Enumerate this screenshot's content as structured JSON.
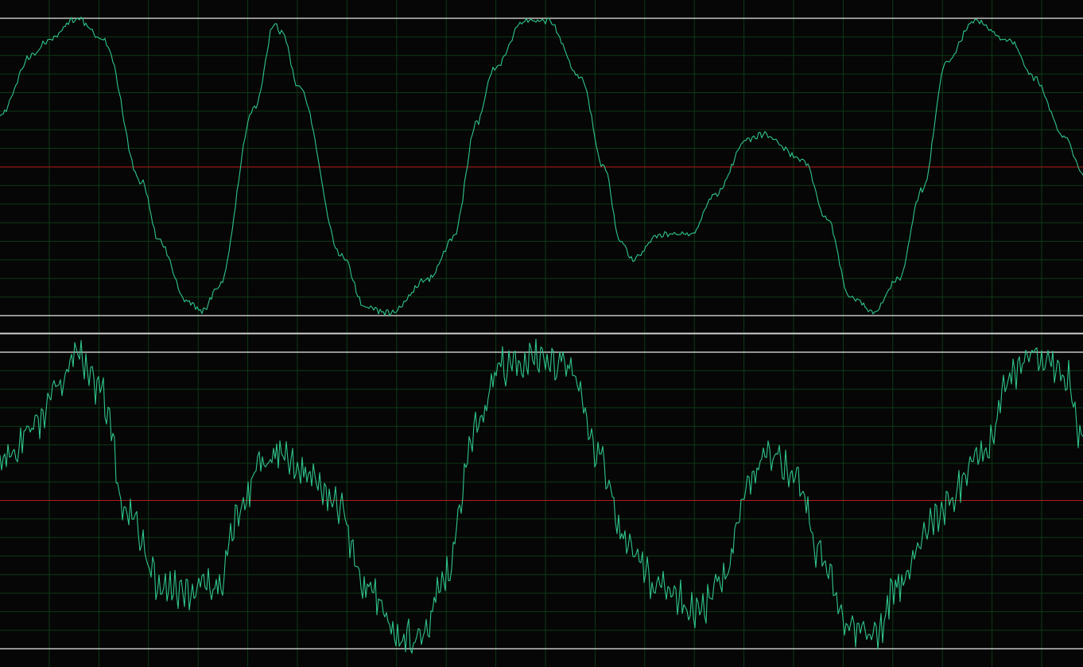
{
  "colors": {
    "background": "#060606",
    "grid": "#0e3a17",
    "waveform": "#2fc58a",
    "clip_line": "#e9e9e9",
    "zero_line": "#b81a1a",
    "divider": "#cfcfcf"
  },
  "waveform_view": {
    "grid_visible": true,
    "channels": [
      {
        "name": "",
        "clip_level_top": 1,
        "clip_level_bottom": -1,
        "zero_line": 0,
        "noise_amplitude": 0.015,
        "envelope": [
          [
            0,
            -0.35
          ],
          [
            40,
            -0.75
          ],
          [
            60,
            -0.85
          ],
          [
            97,
            -1.0
          ],
          [
            130,
            -0.85
          ],
          [
            178,
            0.1
          ],
          [
            200,
            0.5
          ],
          [
            235,
            0.9
          ],
          [
            255,
            0.97
          ],
          [
            275,
            0.8
          ],
          [
            320,
            -0.4
          ],
          [
            345,
            -0.95
          ],
          [
            355,
            -0.9
          ],
          [
            375,
            -0.55
          ],
          [
            430,
            0.6
          ],
          [
            460,
            0.95
          ],
          [
            490,
            0.98
          ],
          [
            540,
            0.75
          ],
          [
            570,
            0.48
          ],
          [
            600,
            -0.3
          ],
          [
            620,
            -0.65
          ],
          [
            660,
            -0.98
          ],
          [
            690,
            -0.98
          ],
          [
            730,
            -0.6
          ],
          [
            760,
            0.0
          ],
          [
            780,
            0.5
          ],
          [
            795,
            0.62
          ],
          [
            830,
            0.45
          ],
          [
            870,
            0.45
          ],
          [
            900,
            0.18
          ],
          [
            940,
            -0.18
          ],
          [
            960,
            -0.22
          ],
          [
            1010,
            -0.05
          ],
          [
            1040,
            0.35
          ],
          [
            1070,
            0.88
          ],
          [
            1100,
            0.97
          ],
          [
            1130,
            0.75
          ],
          [
            1160,
            0.15
          ],
          [
            1190,
            -0.7
          ],
          [
            1225,
            -0.98
          ],
          [
            1270,
            -0.85
          ],
          [
            1300,
            -0.6
          ],
          [
            1340,
            -0.2
          ],
          [
            1362,
            0.05
          ]
        ]
      },
      {
        "name": "",
        "clip_level_top": 1,
        "clip_level_bottom": -1,
        "zero_line": 0,
        "noise_amplitude": 0.09,
        "envelope": [
          [
            0,
            -0.28
          ],
          [
            45,
            -0.5
          ],
          [
            70,
            -0.75
          ],
          [
            97,
            -0.98
          ],
          [
            125,
            -0.75
          ],
          [
            160,
            0.05
          ],
          [
            200,
            0.55
          ],
          [
            240,
            0.62
          ],
          [
            275,
            0.55
          ],
          [
            300,
            0.1
          ],
          [
            330,
            -0.25
          ],
          [
            350,
            -0.32
          ],
          [
            380,
            -0.2
          ],
          [
            420,
            0.0
          ],
          [
            460,
            0.6
          ],
          [
            500,
            0.9
          ],
          [
            530,
            0.95
          ],
          [
            560,
            0.5
          ],
          [
            600,
            -0.5
          ],
          [
            630,
            -0.9
          ],
          [
            680,
            -0.97
          ],
          [
            720,
            -0.9
          ],
          [
            750,
            -0.3
          ],
          [
            790,
            0.3
          ],
          [
            830,
            0.6
          ],
          [
            880,
            0.75
          ],
          [
            910,
            0.5
          ],
          [
            940,
            -0.1
          ],
          [
            970,
            -0.32
          ],
          [
            1000,
            -0.2
          ],
          [
            1030,
            0.35
          ],
          [
            1070,
            0.85
          ],
          [
            1100,
            0.92
          ],
          [
            1130,
            0.55
          ],
          [
            1180,
            0.08
          ],
          [
            1240,
            -0.35
          ],
          [
            1270,
            -0.85
          ],
          [
            1300,
            -0.97
          ],
          [
            1340,
            -0.85
          ],
          [
            1362,
            -0.4
          ]
        ]
      }
    ]
  }
}
